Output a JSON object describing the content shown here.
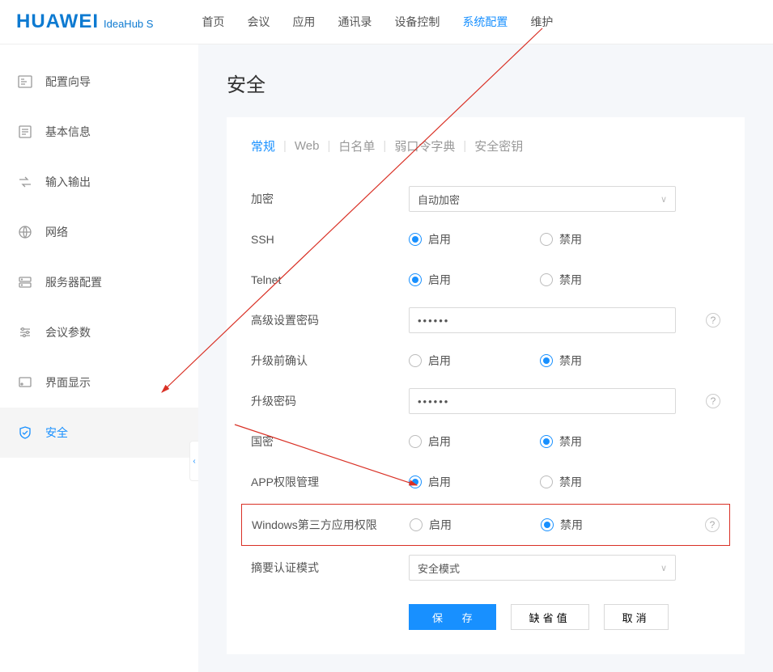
{
  "brand": {
    "logo": "HUAWEI",
    "product": "IdeaHub S"
  },
  "nav": [
    "首页",
    "会议",
    "应用",
    "通讯录",
    "设备控制",
    "系统配置",
    "维护"
  ],
  "nav_active_index": 5,
  "sidebar": {
    "items": [
      {
        "label": "配置向导"
      },
      {
        "label": "基本信息"
      },
      {
        "label": "输入输出"
      },
      {
        "label": "网络"
      },
      {
        "label": "服务器配置"
      },
      {
        "label": "会议参数"
      },
      {
        "label": "界面显示"
      },
      {
        "label": "安全"
      }
    ],
    "active_index": 7
  },
  "page": {
    "title": "安全"
  },
  "tabs": [
    "常规",
    "Web",
    "白名单",
    "弱口令字典",
    "安全密钥"
  ],
  "tabs_active_index": 0,
  "form": {
    "encryption": {
      "label": "加密",
      "value": "自动加密"
    },
    "ssh": {
      "label": "SSH",
      "enable": "启用",
      "disable": "禁用",
      "selected": "enable"
    },
    "telnet": {
      "label": "Telnet",
      "enable": "启用",
      "disable": "禁用",
      "selected": "enable"
    },
    "adv_pwd": {
      "label": "高级设置密码",
      "value": "••••••"
    },
    "upgrade_confirm": {
      "label": "升级前确认",
      "enable": "启用",
      "disable": "禁用",
      "selected": "disable"
    },
    "upgrade_pwd": {
      "label": "升级密码",
      "value": "••••••"
    },
    "gm": {
      "label": "国密",
      "enable": "启用",
      "disable": "禁用",
      "selected": "disable"
    },
    "app_perm": {
      "label": "APP权限管理",
      "enable": "启用",
      "disable": "禁用",
      "selected": "enable"
    },
    "win3rd": {
      "label": "Windows第三方应用权限",
      "enable": "启用",
      "disable": "禁用",
      "selected": "disable"
    },
    "digest": {
      "label": "摘要认证模式",
      "value": "安全模式"
    }
  },
  "buttons": {
    "save": "保 存",
    "default": "缺省值",
    "cancel": "取消"
  }
}
